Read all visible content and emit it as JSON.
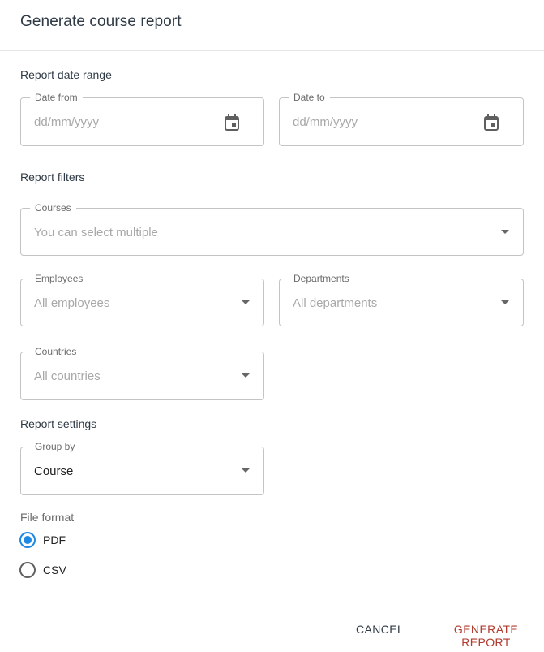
{
  "dialog": {
    "title": "Generate course report"
  },
  "date_range": {
    "heading": "Report date range",
    "from": {
      "label": "Date from",
      "placeholder": "dd/mm/yyyy",
      "icon": "calendar-icon"
    },
    "to": {
      "label": "Date to",
      "placeholder": "dd/mm/yyyy",
      "icon": "calendar-icon"
    }
  },
  "filters": {
    "heading": "Report filters",
    "courses": {
      "label": "Courses",
      "placeholder": "You can select multiple"
    },
    "employees": {
      "label": "Employees",
      "placeholder": "All employees"
    },
    "departments": {
      "label": "Departments",
      "placeholder": "All departments"
    },
    "countries": {
      "label": "Countries",
      "placeholder": "All countries"
    }
  },
  "settings": {
    "heading": "Report settings",
    "group_by": {
      "label": "Group by",
      "value": "Course"
    },
    "file_format": {
      "label": "File format",
      "options": [
        {
          "label": "PDF",
          "checked": true
        },
        {
          "label": "CSV",
          "checked": false
        }
      ]
    }
  },
  "actions": {
    "cancel": "CANCEL",
    "generate": "GENERATE REPORT"
  },
  "colors": {
    "accent_radio": "#1e88e5",
    "generate_text": "#b13b2e",
    "heading_text": "#2f3a45"
  }
}
